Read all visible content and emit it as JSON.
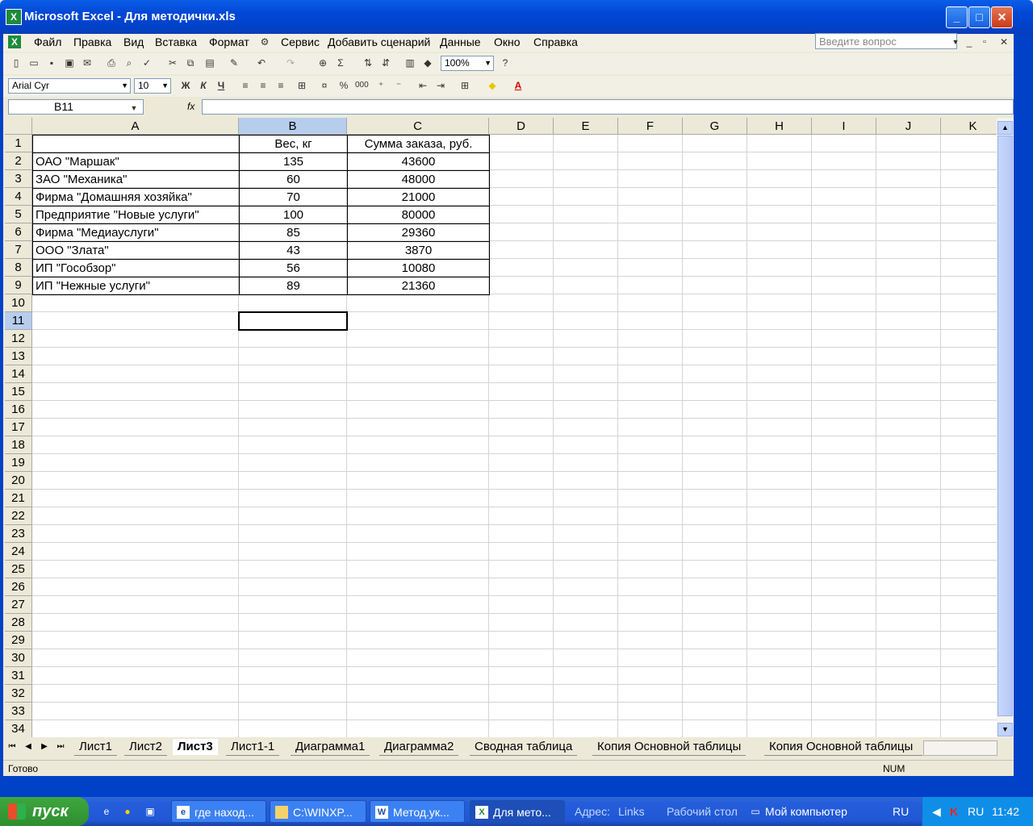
{
  "window": {
    "title": "Microsoft Excel - Для методички.xls",
    "app_icon": "X",
    "controls": {
      "minimize": "_",
      "maximize": "□",
      "close": "✕"
    }
  },
  "menu": {
    "items": [
      "Файл",
      "Правка",
      "Вид",
      "Вставка",
      "Формат",
      "Сервис",
      "Добавить сценарий",
      "Данные",
      "Окно",
      "Справка"
    ],
    "ask_placeholder": "Введите вопрос"
  },
  "toolbar": {
    "zoom": "100%",
    "font_name": "Arial Cyr",
    "font_size": "10",
    "bold": "Ж",
    "italic": "К",
    "underline": "Ч",
    "percent": "%",
    "thousands": "000",
    "sigma": "Σ",
    "font_color_letter": "A"
  },
  "formula_bar": {
    "name_box": "B11",
    "fx": "fx",
    "value": ""
  },
  "sheet": {
    "columns": [
      "A",
      "B",
      "C",
      "D",
      "E",
      "F",
      "G",
      "H",
      "I",
      "J",
      "K"
    ],
    "rows": [
      "1",
      "2",
      "3",
      "4",
      "5",
      "6",
      "7",
      "8",
      "9",
      "10",
      "11",
      "12",
      "13",
      "14",
      "15",
      "16",
      "17",
      "18",
      "19",
      "20",
      "21",
      "22",
      "23",
      "24",
      "25",
      "26",
      "27",
      "28",
      "29",
      "30",
      "31",
      "32",
      "33",
      "34"
    ],
    "header_row": {
      "a": "",
      "b": "Вес, кг",
      "c": "Сумма заказа, руб."
    },
    "data": [
      {
        "a": "ОАО \"Маршак\"",
        "b": "135",
        "c": "43600"
      },
      {
        "a": "ЗАО \"Механика\"",
        "b": "60",
        "c": "48000"
      },
      {
        "a": "Фирма \"Домашняя хозяйка\"",
        "b": "70",
        "c": "21000"
      },
      {
        "a": "Предприятие \"Новые услуги\"",
        "b": "100",
        "c": "80000"
      },
      {
        "a": "Фирма \"Медиауслуги\"",
        "b": "85",
        "c": "29360"
      },
      {
        "a": "ООО \"Злата\"",
        "b": "43",
        "c": "3870"
      },
      {
        "a": "ИП \"Гособзор\"",
        "b": "56",
        "c": "10080"
      },
      {
        "a": "ИП \"Нежные услуги\"",
        "b": "89",
        "c": "21360"
      }
    ]
  },
  "tabs": [
    "Лист1",
    "Лист2",
    "Лист3",
    "Лист1-1",
    "Диаграмма1",
    "Диаграмма2",
    "Сводная таблица",
    "Копия Основной таблицы",
    "Копия Основной таблицы"
  ],
  "active_tab": "Лист3",
  "status": {
    "left": "Готово",
    "right": "NUM"
  },
  "taskbar": {
    "start": "пуск",
    "tasks": [
      "где наход...",
      "C:\\WINXP...",
      "Метод.ук...",
      "Для мето..."
    ],
    "address_label": "Адрес:",
    "links": "Links",
    "desktop": "Рабочий стол",
    "mycomputer": "Мой компьютер",
    "lang": "RU",
    "lang2": "RU",
    "clock": "11:42"
  }
}
